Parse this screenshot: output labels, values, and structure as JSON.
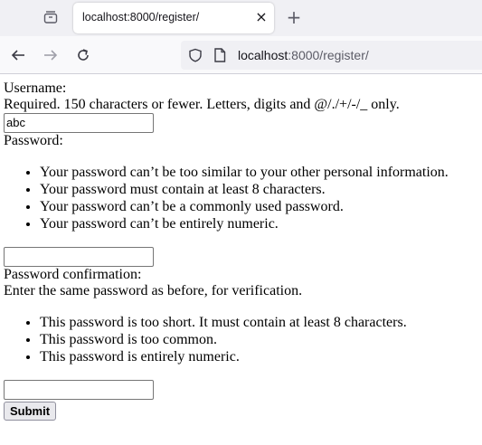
{
  "browser": {
    "tab_title": "localhost:8000/register/",
    "tab_close_glyph": "×",
    "new_tab_glyph": "+",
    "url_host": "localhost",
    "url_rest": ":8000/register/",
    "icons": [
      "tab-overview-icon",
      "back-arrow-icon",
      "forward-arrow-icon",
      "reload-icon",
      "shield-icon",
      "page-icon",
      "close-icon",
      "plus-icon"
    ]
  },
  "form": {
    "username_label": "Username:",
    "username_help": "Required. 150 characters or fewer. Letters, digits and @/./+/-/_ only.",
    "username_value": "abc",
    "password_label": "Password:",
    "password_rules": [
      "Your password can’t be too similar to your other personal information.",
      "Your password must contain at least 8 characters.",
      "Your password can’t be a commonly used password.",
      "Your password can’t be entirely numeric."
    ],
    "password_value": "",
    "confirm_label": "Password confirmation:",
    "confirm_help": "Enter the same password as before, for verification.",
    "confirm_errors": [
      "This password is too short. It must contain at least 8 characters.",
      "This password is too common.",
      "This password is entirely numeric."
    ],
    "confirm_value": "",
    "submit_label": "Submit"
  }
}
